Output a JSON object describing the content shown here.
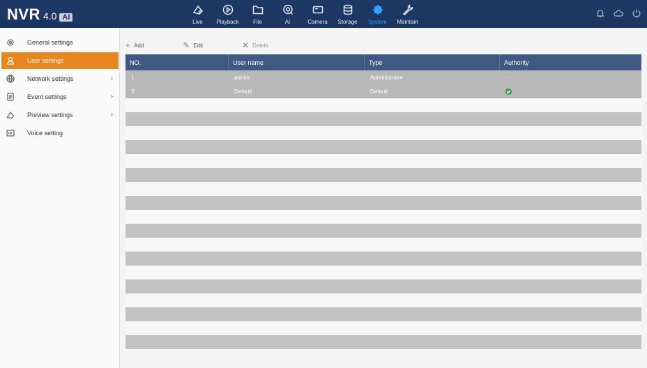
{
  "app": {
    "name": "NVR",
    "version": "4.0",
    "badge": "AI"
  },
  "nav": [
    {
      "label": "Live",
      "icon": "live-icon"
    },
    {
      "label": "Playback",
      "icon": "playback-icon"
    },
    {
      "label": "File",
      "icon": "folder-icon"
    },
    {
      "label": "AI",
      "icon": "ai-icon"
    },
    {
      "label": "Camera",
      "icon": "camera-icon"
    },
    {
      "label": "Storage",
      "icon": "storage-icon"
    },
    {
      "label": "System",
      "icon": "gear-icon",
      "active": true
    },
    {
      "label": "Maintain",
      "icon": "wrench-icon"
    }
  ],
  "sidebar": {
    "items": [
      {
        "label": "General settings",
        "icon": "general-settings-icon"
      },
      {
        "label": "User settings",
        "icon": "user-icon",
        "active": true
      },
      {
        "label": "Network settings",
        "icon": "globe-icon",
        "expandable": true
      },
      {
        "label": "Event settings",
        "icon": "event-icon",
        "expandable": true
      },
      {
        "label": "Preview settings",
        "icon": "preview-icon",
        "expandable": true
      },
      {
        "label": "Voice setting",
        "icon": "voice-icon"
      }
    ]
  },
  "toolbar": {
    "add_label": "Add",
    "edit_label": "Edit",
    "delete_label": "Delete"
  },
  "table": {
    "columns": [
      "NO.",
      "User name",
      "Type",
      "Authority"
    ],
    "rows": [
      {
        "no": "1",
        "user": "admin",
        "type": "Administrator",
        "authority": "-"
      },
      {
        "no": "2",
        "user": "Default",
        "type": "Default",
        "authority": "check"
      }
    ]
  },
  "colors": {
    "topbar": "#1d3a66",
    "active_nav": "#2fa4ff",
    "active_sidebar": "#e8861f",
    "table_header": "#3e5a84",
    "authority_check": "#2e9e3e"
  }
}
